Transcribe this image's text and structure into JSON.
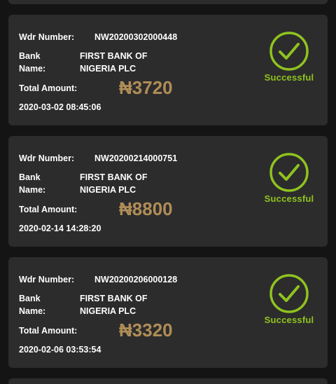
{
  "labels": {
    "wdr_number": "Wdr Number:",
    "bank_name_line1": "Bank",
    "bank_name_line2": "Name:",
    "total_amount": "Total Amount:"
  },
  "colors": {
    "background": "#141414",
    "card": "#2c2c2c",
    "amount": "#b08d57",
    "success": "#8fc31f"
  },
  "records": [
    {
      "wdr_number": "NW20200302000448",
      "bank_line1": "FIRST BANK OF",
      "bank_line2": "NIGERIA PLC",
      "amount": "₦3720",
      "date": "2020-03-02 08:45:06",
      "status": "Successful",
      "status_icon": "check-circle-icon"
    },
    {
      "wdr_number": "NW20200214000751",
      "bank_line1": "FIRST BANK OF",
      "bank_line2": "NIGERIA PLC",
      "amount": "₦8800",
      "date": "2020-02-14 14:28:20",
      "status": "Successful",
      "status_icon": "check-circle-icon"
    },
    {
      "wdr_number": "NW20200206000128",
      "bank_line1": "FIRST BANK OF",
      "bank_line2": "NIGERIA PLC",
      "amount": "₦3320",
      "date": "2020-02-06 03:53:54",
      "status": "Successful",
      "status_icon": "check-circle-icon"
    }
  ]
}
